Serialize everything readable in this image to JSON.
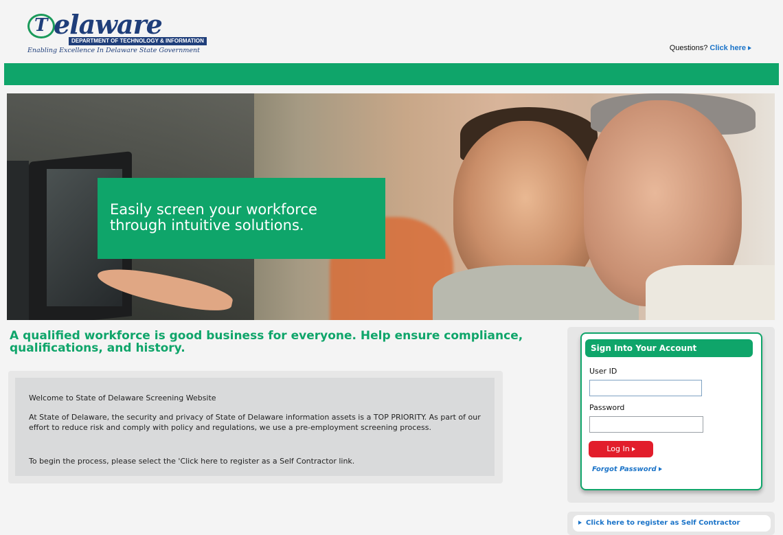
{
  "colors": {
    "brand_green": "#0fa56a",
    "link_blue": "#1a73c8",
    "login_red": "#e21d2b",
    "logo_navy": "#1f3e7a"
  },
  "header": {
    "logo": {
      "word": "elaware",
      "mark": "T",
      "band": "DEPARTMENT OF TECHNOLOGY & INFORMATION",
      "tagline": "Enabling Excellence In Delaware State Government"
    },
    "questions_label": "Questions?",
    "questions_link": "Click here"
  },
  "hero": {
    "line1": "Easily screen your workforce",
    "line2": "through intuitive solutions."
  },
  "tagline": "A qualified workforce is good business for everyone. Help ensure compliance, qualifications, and history.",
  "welcome": {
    "title": "Welcome to State of Delaware Screening Website",
    "body": "At State of Delaware, the security and privacy of State of Delaware information assets is a TOP PRIORITY. As part of our effort to reduce risk and comply with policy and regulations, we use a pre-employment screening process.",
    "instruction": "To begin the process, please select the 'Click here to register as a Self Contractor link."
  },
  "login": {
    "title": "Sign Into Your Account",
    "userid_label": "User ID",
    "userid_value": "",
    "password_label": "Password",
    "password_value": "",
    "login_button": "Log In",
    "forgot_link": "Forgot Password"
  },
  "register_link": "Click here to register as Self Contractor"
}
